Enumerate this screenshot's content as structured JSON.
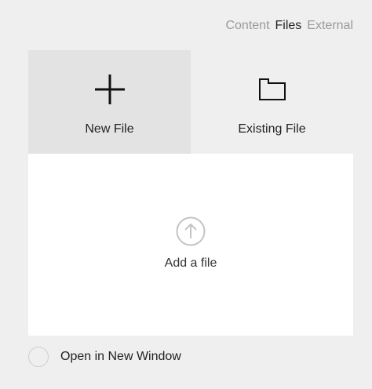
{
  "tabs": [
    {
      "label": "Content",
      "active": false
    },
    {
      "label": "Files",
      "active": true
    },
    {
      "label": "External",
      "active": false
    }
  ],
  "options": {
    "new_file": {
      "label": "New File",
      "icon": "plus-icon",
      "selected": true
    },
    "existing_file": {
      "label": "Existing File",
      "icon": "folder-icon",
      "selected": false
    }
  },
  "dropzone": {
    "label": "Add a file",
    "icon": "upload-arrow-icon"
  },
  "open_in_new_window": {
    "label": "Open in New Window",
    "checked": false
  }
}
